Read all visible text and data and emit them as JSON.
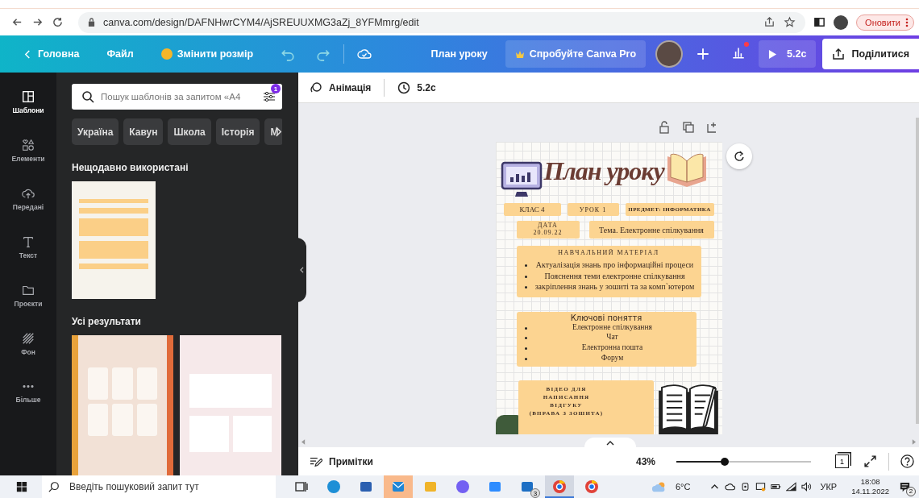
{
  "browser": {
    "url": "canva.com/design/DAFNHwrCYM4/AjSREUUXMG3aZj_8YFMmrg/edit",
    "update_button": "Оновити"
  },
  "header": {
    "home": "Головна",
    "file": "Файл",
    "resize": "Змінити розмір",
    "title": "План уроку",
    "pro": "Спробуйте Canva Pro",
    "play": "5.2с",
    "share": "Поділитися",
    "notification_dot": true
  },
  "rail": [
    {
      "kind": "templates",
      "label": "Шаблони",
      "selected": true
    },
    {
      "kind": "elements",
      "label": "Елементи",
      "selected": false
    },
    {
      "kind": "uploads",
      "label": "Передані",
      "selected": false
    },
    {
      "kind": "text",
      "label": "Текст",
      "selected": false
    },
    {
      "kind": "projects",
      "label": "Проєкти",
      "selected": false
    },
    {
      "kind": "background",
      "label": "Фон",
      "selected": false
    },
    {
      "kind": "more",
      "label": "Більше",
      "selected": false
    }
  ],
  "panel": {
    "search": {
      "placeholder": "Пошук шаблонів за запитом «А4"
    },
    "filter_badge": "1",
    "chips": [
      "Україна",
      "Кавун",
      "Школа",
      "Історія",
      "М"
    ],
    "recent_heading": "Нещодавно використані",
    "recent": [
      {
        "kind": "grid"
      }
    ],
    "all_heading": "Усі результати",
    "results": [
      {
        "kind": "autumn"
      },
      {
        "kind": "pink"
      }
    ]
  },
  "toolbar": {
    "animation": "Анімація",
    "duration": "5.2с"
  },
  "design": {
    "title": "План уроку",
    "class": "КЛАС 4",
    "lesson": "УРОК 1",
    "subject": "ПРЕДМЕТ: ІНФОРМАТИКА",
    "date_label": "ДАТА",
    "date": "20.09.22",
    "topic": "Тема. Електронне спілкування",
    "material_heading": "НАВЧАЛЬНИЙ МАТЕРІАЛ",
    "material": [
      "Актуалізація знань про інформаційні процеси",
      "Пояснення теми електронне спілкування",
      "закріплення знань у зошиті та за комп`ютером"
    ],
    "concepts_heading": "Ключові поняття",
    "concepts": [
      "Електронне спілкування",
      "Чат",
      "Електронна пошта",
      "Форум"
    ],
    "video": [
      "ВІДЕО ДЛЯ",
      "НАПИСАННЯ ВІДГУКУ",
      "(ВПРАВА З ЗОШИТА)"
    ]
  },
  "bottom": {
    "notes": "Примітки",
    "zoom": "43%",
    "level": 0.36,
    "page": "1"
  },
  "taskbar": {
    "search": {
      "placeholder": "Введіть пошуковий запит тут"
    },
    "apps": [
      {
        "kind": "taskview",
        "highlighted": false,
        "active": false
      },
      {
        "kind": "edge",
        "highlighted": false,
        "active": false
      },
      {
        "kind": "store",
        "highlighted": false,
        "active": false
      },
      {
        "kind": "mail",
        "highlighted": true,
        "active": false
      },
      {
        "kind": "folder",
        "highlighted": false,
        "active": false
      },
      {
        "kind": "viber",
        "highlighted": false,
        "active": false
      },
      {
        "kind": "zoom",
        "highlighted": false,
        "active": false
      },
      {
        "kind": "app",
        "highlighted": false,
        "active": false,
        "badge": "3"
      },
      {
        "kind": "chrome",
        "highlighted": false,
        "active": true
      },
      {
        "kind": "chrome",
        "highlighted": false,
        "active": false
      }
    ],
    "temperature": "6°C",
    "language": "УКР",
    "time": "18:08",
    "date": "14.11.2022",
    "notifications": "2"
  }
}
